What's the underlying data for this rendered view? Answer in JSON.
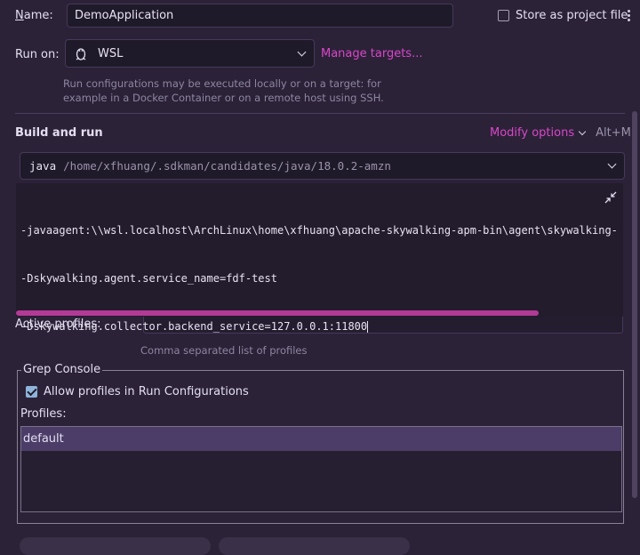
{
  "name_row": {
    "label": "Name:",
    "value": "DemoApplication"
  },
  "store_project_file": {
    "label": "Store as project file",
    "checked": false
  },
  "run_on": {
    "label": "Run on:",
    "target": "WSL",
    "manage_targets": "Manage targets...",
    "hint_line1": "Run configurations may be executed locally or on a target: for",
    "hint_line2": "example in a Docker Container or on a remote host using SSH."
  },
  "build_and_run": {
    "title": "Build and run",
    "modify_options": "Modify options",
    "shortcut": "Alt+M",
    "jre_keyword": "java",
    "jre_path": "/home/xfhuang/.sdkman/candidates/java/18.0.2-amzn"
  },
  "vm_options": {
    "line1": "-javaagent:\\\\wsl.localhost\\ArchLinux\\home\\xfhuang\\apache-skywalking-apm-bin\\agent\\skywalking-",
    "line2": "-Dskywalking.agent.service_name=fdf-test",
    "line3": "-Dskywalking.collector.backend_service=127.0.0.1:11800"
  },
  "active_profiles": {
    "label": "Active profiles:",
    "hint": "Comma separated list of profiles"
  },
  "grep_console": {
    "title": "Grep Console",
    "allow_profiles_label": "Allow profiles in Run Configurations",
    "allow_profiles_checked": true,
    "profiles_label": "Profiles:",
    "profiles": [
      "default"
    ]
  },
  "colors": {
    "accent": "#d946c8",
    "background": "#2b2238",
    "selection": "#4b3d68"
  },
  "icons": {
    "wsl": "linux-penguin-icon",
    "collapse": "collapse-arrows-icon",
    "more": "vertical-dots-icon"
  }
}
